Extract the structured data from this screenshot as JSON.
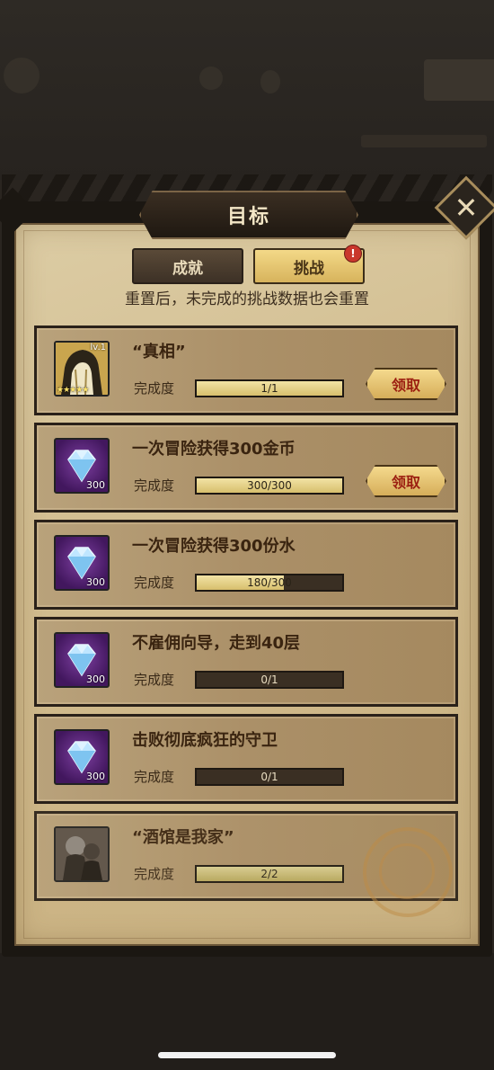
{
  "dialog": {
    "title": "目标",
    "close_icon": "close-icon"
  },
  "tabs": [
    {
      "label": "成就",
      "active": false
    },
    {
      "label": "挑战",
      "active": true,
      "badge": "!"
    }
  ],
  "reset_note": "重置后，未完成的挑战数据也会重置",
  "progress_label": "完成度",
  "claim_label": "领取",
  "challenges": [
    {
      "title": "“真相”",
      "icon": "hero-portrait-icon",
      "hero_level": "lv.1",
      "stars": "★★★★★",
      "progress_text": "1/1",
      "progress": 1.0,
      "claimable": true
    },
    {
      "title": "一次冒险获得300金币",
      "icon": "diamond-icon",
      "reward": "300",
      "progress_text": "300/300",
      "progress": 1.0,
      "claimable": true
    },
    {
      "title": "一次冒险获得300份水",
      "icon": "diamond-icon",
      "reward": "300",
      "progress_text": "180/300",
      "progress": 0.6,
      "claimable": false
    },
    {
      "title": "不雇佣向导，走到40层",
      "icon": "diamond-icon",
      "reward": "300",
      "progress_text": "0/1",
      "progress": 0.0,
      "claimable": false
    },
    {
      "title": "击败彻底疯狂的守卫",
      "icon": "diamond-icon",
      "reward": "300",
      "progress_text": "0/1",
      "progress": 0.0,
      "claimable": false
    },
    {
      "title": "“酒馆是我家”",
      "icon": "tavern-character-icon",
      "progress_text": "2/2",
      "progress": 1.0,
      "claimable": false,
      "completed": true
    }
  ]
}
